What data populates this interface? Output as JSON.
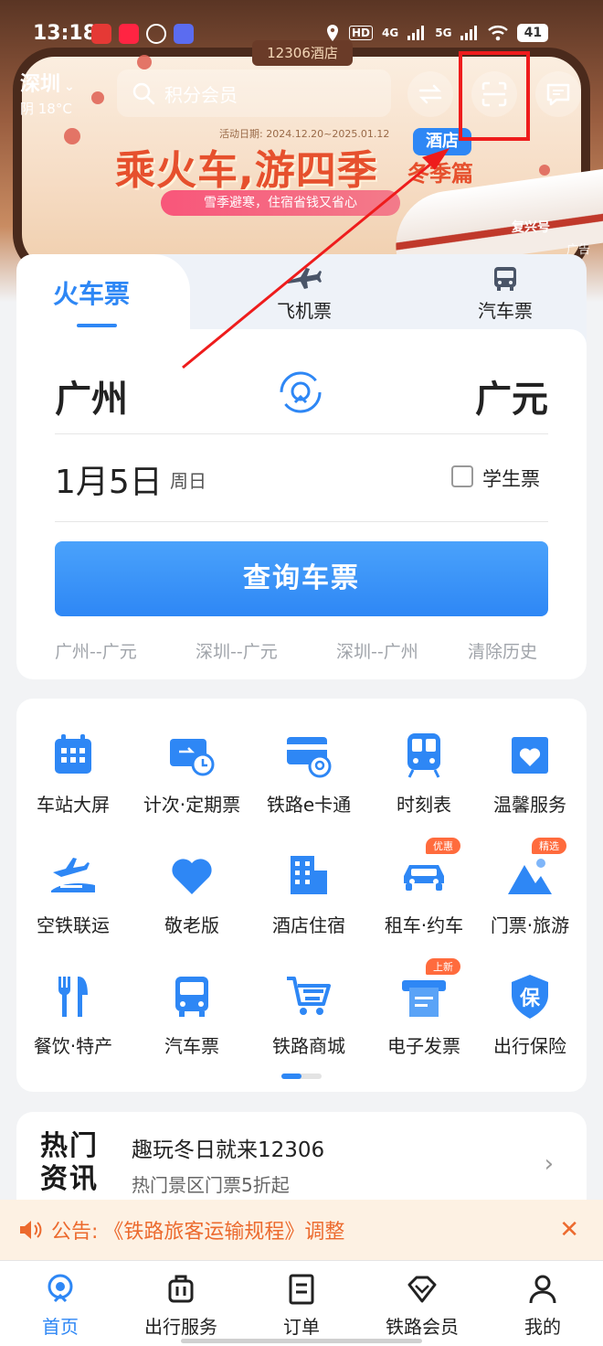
{
  "status_bar": {
    "time": "13:18",
    "network_1": "4G",
    "network_2": "5G",
    "hd_label": "HD",
    "battery": "41"
  },
  "header": {
    "city": "深圳",
    "weather": "阴 18°C",
    "search_placeholder": "积分会员"
  },
  "banner": {
    "hotel_tag": "12306酒店",
    "activity_date": "活动日期: 2024.12.20~2025.01.12",
    "title": "乘火车,游四季",
    "season": "冬季篇",
    "hotel_badge": "酒店",
    "subtitle": "雪季避寒，住宿省钱又省心",
    "train_name": "复兴号",
    "ad_label": "广告"
  },
  "ticket": {
    "tabs": [
      {
        "label": "火车票",
        "icon": "train"
      },
      {
        "label": "飞机票",
        "icon": "airplane-icon"
      },
      {
        "label": "汽车票",
        "icon": "bus-icon"
      }
    ],
    "from": "广州",
    "to": "广元",
    "date": "1月5日",
    "weekday": "周日",
    "student_label": "学生票",
    "search_button": "查询车票",
    "history": [
      "广州--广元",
      "深圳--广元",
      "深圳--广州"
    ],
    "clear_history": "清除历史"
  },
  "services": [
    {
      "label": "车站大屏",
      "icon": "calendar-grid-icon"
    },
    {
      "label": "计次·定期票",
      "icon": "ticket-clock-icon"
    },
    {
      "label": "铁路e卡通",
      "icon": "card-icon"
    },
    {
      "label": "时刻表",
      "icon": "metro-train-icon"
    },
    {
      "label": "温馨服务",
      "icon": "heart-box-icon"
    },
    {
      "label": "空铁联运",
      "icon": "plane-train-icon"
    },
    {
      "label": "敬老版",
      "icon": "heart-icon"
    },
    {
      "label": "酒店住宿",
      "icon": "building-icon"
    },
    {
      "label": "租车·约车",
      "icon": "car-icon",
      "badge": "优惠"
    },
    {
      "label": "门票·旅游",
      "icon": "mountain-icon",
      "badge": "精选"
    },
    {
      "label": "餐饮·特产",
      "icon": "fork-knife-icon"
    },
    {
      "label": "汽车票",
      "icon": "bus-icon"
    },
    {
      "label": "铁路商城",
      "icon": "cart-icon"
    },
    {
      "label": "电子发票",
      "icon": "receipt-icon",
      "badge": "上新"
    },
    {
      "label": "出行保险",
      "icon": "shield-icon",
      "badge_text": "保"
    }
  ],
  "news": {
    "logo_line1": "热门",
    "logo_line2": "资讯",
    "title": "趣玩冬日就来12306",
    "subtitle": "热门景区门票5折起"
  },
  "notice": {
    "label": "公告:",
    "message": "《铁路旅客运输规程》调整"
  },
  "bottom_nav": [
    {
      "label": "首页",
      "icon": "home-icon",
      "active": true
    },
    {
      "label": "出行服务",
      "icon": "luggage-icon"
    },
    {
      "label": "订单",
      "icon": "order-icon"
    },
    {
      "label": "铁路会员",
      "icon": "diamond-icon"
    },
    {
      "label": "我的",
      "icon": "user-icon"
    }
  ],
  "colors": {
    "accent": "#2e87f5",
    "notice": "#ec6a2e",
    "highlight": "#ee1c1c"
  }
}
